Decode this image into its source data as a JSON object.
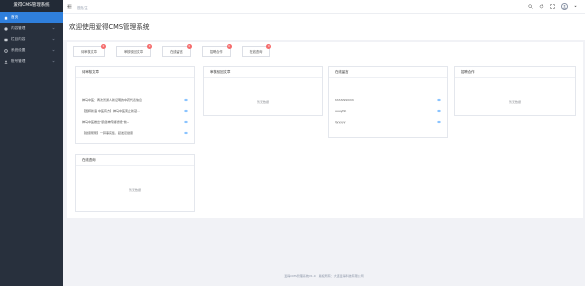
{
  "app_title": "爱得CMS管理系统",
  "sidebar": {
    "items": [
      {
        "label": "首页",
        "icon": "home-icon",
        "active": true
      },
      {
        "label": "内容管理",
        "icon": "content-icon",
        "has_children": true
      },
      {
        "label": "栏目内容",
        "icon": "column-icon",
        "has_children": true
      },
      {
        "label": "系统设置",
        "icon": "settings-icon",
        "has_children": true
      },
      {
        "label": "账号管理",
        "icon": "account-icon",
        "has_children": true
      }
    ]
  },
  "topbar": {
    "breadcrumb": "首页/主"
  },
  "welcome_title": "欢迎使用爱得CMS管理系统",
  "tabs": [
    {
      "label": "待审核文章",
      "badge": "0"
    },
    {
      "label": "审核驳回文章",
      "badge": "0"
    },
    {
      "label": "在线留言",
      "badge": "0"
    },
    {
      "label": "招聘合作",
      "badge": "0"
    },
    {
      "label": "在线咨询",
      "badge": "0"
    }
  ],
  "panels": {
    "pending_articles": {
      "title": "待审核文章",
      "items": [
        "神马中医：再次普通人新证明的中药代表信息",
        "【国粹新语 中医有方】神马中医离止新冠…",
        "神马中医推出\"肌健神传播智能\"前~",
        "【健康帮帮】一碎事实集、起发足健康"
      ]
    },
    "rejected_articles": {
      "title": "审核驳回文章",
      "empty": "暂无数据"
    },
    "online_messages": {
      "title": "在线留言",
      "items": [
        "hhhhhhhhhh",
        "uuuyhh",
        "ljyyyyy"
      ]
    },
    "recruitment": {
      "title": "招聘合作",
      "empty": "暂无数据"
    },
    "online_consult": {
      "title": "在线咨询",
      "empty": "暂无数据"
    }
  },
  "footer": "爱得CMS管理系统V1.0　版权所有：大连爱得科技有限公司"
}
